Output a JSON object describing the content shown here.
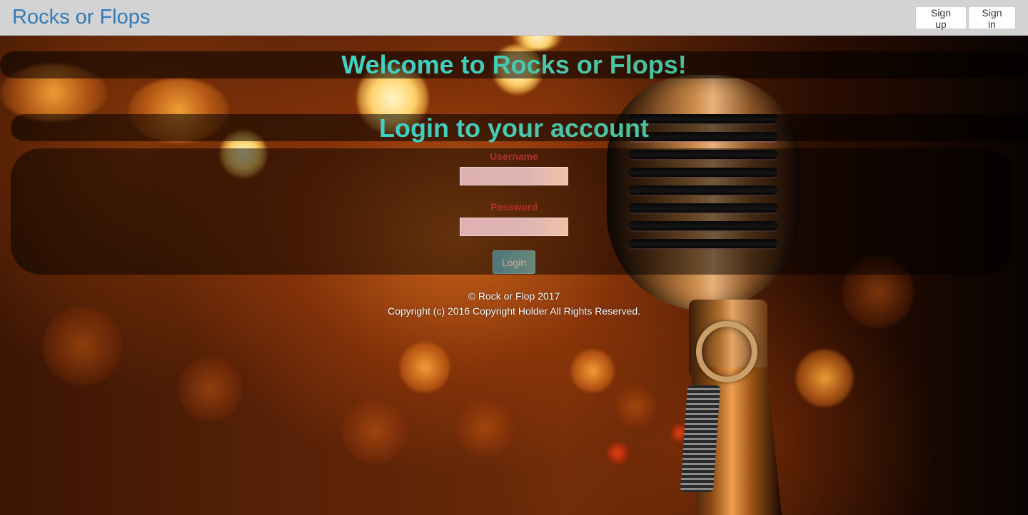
{
  "navbar": {
    "brand": "Rocks or Flops",
    "signup_label": "Sign up",
    "signin_label": "Sign in"
  },
  "hero": {
    "welcome_title": "Welcome to Rocks or Flops!",
    "login_title": "Login to your account"
  },
  "login_form": {
    "username_label": "Username",
    "username_value": "",
    "password_label": "Password",
    "password_value": "",
    "submit_label": "Login"
  },
  "footer": {
    "line1": "© Rock or Flop 2017",
    "line2": "Copyright (c) 2016 Copyright Holder All Rights Reserved."
  },
  "colors": {
    "brand": "#337ab7",
    "navbar_bg": "#d3d3d3",
    "title_gradient_start": "#47d9cf",
    "title_gradient_end": "#37b0a3",
    "field_label": "#b3302b"
  }
}
